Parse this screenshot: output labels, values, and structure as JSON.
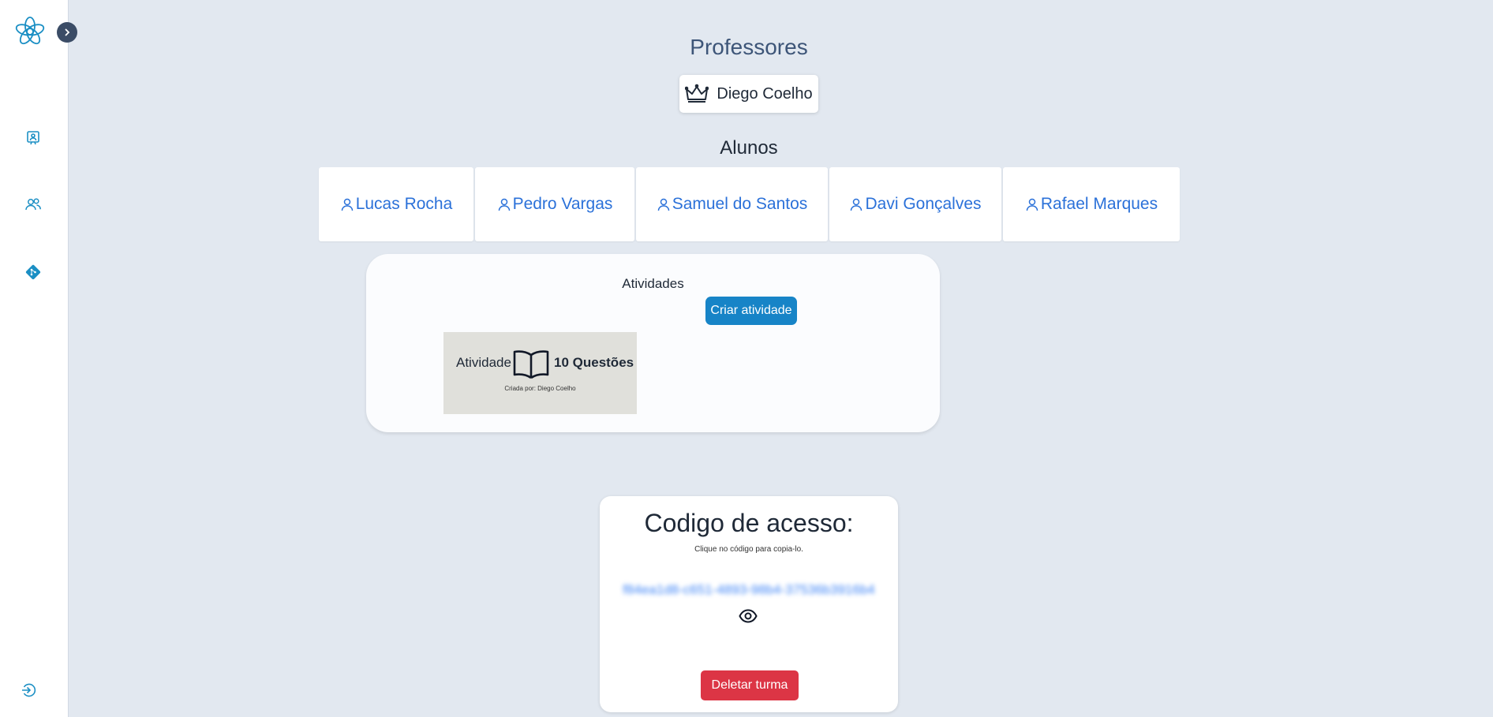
{
  "sidebar": {
    "logo_icon": "flower-logo",
    "expand_icon": "chevron-right-icon",
    "nav_items": [
      {
        "icon": "presentation-icon"
      },
      {
        "icon": "users-icon"
      },
      {
        "icon": "git-diamond-icon"
      }
    ],
    "logout_icon": "logout-icon"
  },
  "teachers": {
    "title": "Professores",
    "items": [
      {
        "name": "Diego Coelho",
        "icon": "crown-icon"
      }
    ]
  },
  "students": {
    "title": "Alunos",
    "items": [
      {
        "name": "Lucas Rocha"
      },
      {
        "name": "Pedro Vargas"
      },
      {
        "name": "Samuel do Santos"
      },
      {
        "name": "Davi Gonçalves"
      },
      {
        "name": "Rafael Marques"
      }
    ]
  },
  "activities": {
    "title": "Atividades",
    "create_label": "Criar atividade",
    "items": [
      {
        "label": "Atividade",
        "questions": "10 Questões",
        "created_by": "Criada por: Diego Coelho",
        "icon": "book-icon"
      }
    ]
  },
  "access": {
    "title": "Codigo de acesso:",
    "hint": "Clique no código para copia-lo.",
    "code": "f84ea1d8-c651-4893-98b4-37536b3916b4",
    "delete_label": "Deletar turma"
  },
  "colors": {
    "background": "#e2e8f0",
    "accent": "#1784c7",
    "link": "#2b71d9",
    "danger": "#dc3545",
    "heading": "#3d5578"
  }
}
